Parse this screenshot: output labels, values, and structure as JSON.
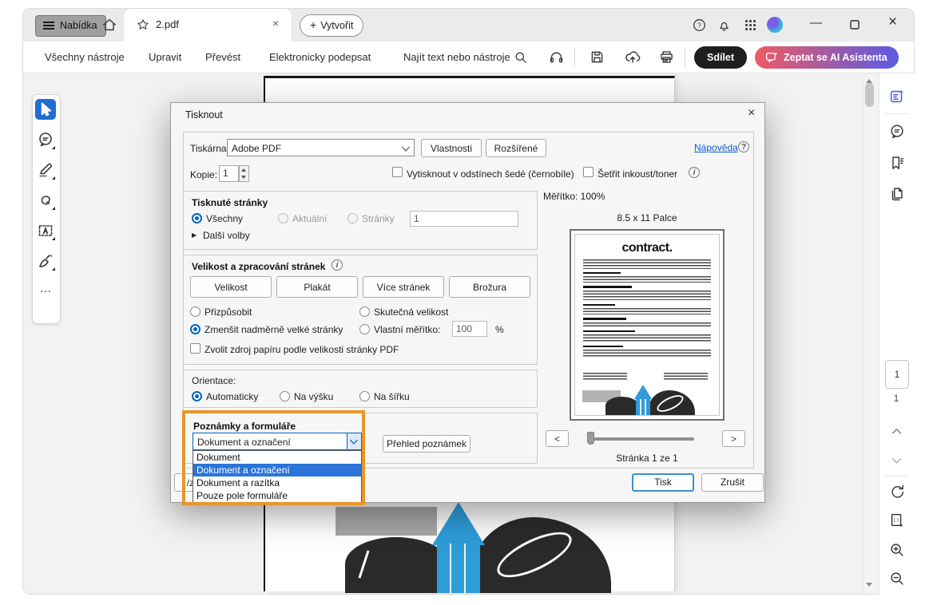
{
  "colors": {
    "accent_orange": "#E8962A",
    "selection_blue": "#2B74D9",
    "focus_blue": "#0067C0",
    "ai_grad_start": "#EF5B63",
    "ai_grad_end": "#5A5BE4",
    "share_black": "#1F1F1F",
    "pencil_blue": "#2E9CD9",
    "tool_active_blue": "#1E6ED6",
    "link_blue": "#0B5BD3",
    "ai_purple": "#5B5BE0"
  },
  "titlebar": {
    "menu": "Nabídka",
    "tab_title": "2.pdf",
    "create": "Vytvořit",
    "close_glyph": "×",
    "minimize_glyph": "—"
  },
  "toolbar": {
    "items": [
      "Všechny nástroje",
      "Upravit",
      "Převést",
      "Elektronicky podepsat"
    ],
    "search": "Najít text nebo nástroje",
    "share": "Sdílet",
    "ai": "Zeptat se AI Asistenta"
  },
  "right_panel": {
    "page_thumb": "1",
    "page_number": "1"
  },
  "print_dialog": {
    "title": "Tisknout",
    "close_glyph": "×",
    "printer": {
      "label": "Tiskárna:",
      "value": "Adobe PDF",
      "properties": "Vlastnosti",
      "advanced": "Rozšířené",
      "help": "Nápověda",
      "help_glyph": "?"
    },
    "copies": {
      "label": "Kopie:",
      "value": "1"
    },
    "grayscale_label": "Vytisknout v odstínech šedé (černobíle)",
    "save_ink_label": "Šetřit inkoust/toner",
    "info_glyph": "i",
    "pages_section": {
      "title": "Tisknuté stránky",
      "all": "Všechny",
      "current": "Aktuální",
      "pages": "Stránky",
      "pages_value": "1",
      "more_glyph": "▶",
      "more": "Další volby"
    },
    "size_section": {
      "title": "Velikost a zpracování stránek",
      "buttons": [
        "Velikost",
        "Plakát",
        "Více stránek",
        "Brožura"
      ],
      "fit": "Přizpůsobit",
      "actual": "Skutečná velikost",
      "shrink": "Zmenšit nadměrně velké stránky",
      "custom": "Vlastní měřítko:",
      "custom_value": "100",
      "percent": "%",
      "paper_source": "Zvolit zdroj papíru podle velikosti stránky PDF"
    },
    "orientation_section": {
      "title": "Orientace:",
      "auto": "Automaticky",
      "portrait": "Na výšku",
      "landscape": "Na šířku"
    },
    "comments_section": {
      "title": "Poznámky a formuláře",
      "selected": "Dokument a označení",
      "options": [
        "Dokument",
        "Dokument a označení",
        "Dokument a razítka",
        "Pouze pole formuláře"
      ],
      "summary_button": "Přehled poznámek"
    },
    "footer_fragment": "/z",
    "preview": {
      "scale_label": "Měřítko: 100%",
      "size_label": "8.5 x 11 Palce",
      "doc_title": "contract.",
      "prev": "<",
      "next": ">",
      "page_label": "Stránka 1 ze 1"
    },
    "actions": {
      "print": "Tisk",
      "cancel": "Zrušit"
    }
  },
  "icons": [
    "hamburger-icon",
    "home-icon",
    "star-icon",
    "tab-close-icon",
    "plus-icon",
    "search-icon",
    "headphones-icon",
    "save-icon",
    "cloud-upload-icon",
    "print-icon",
    "help-icon",
    "bell-icon",
    "apps-grid-icon",
    "avatar",
    "minimize-icon",
    "maximize-icon",
    "window-close-icon",
    "select-tool-icon",
    "comment-tool-icon",
    "highlight-tool-icon",
    "draw-tool-icon",
    "text-select-tool-icon",
    "sign-tool-icon",
    "more-tools-icon",
    "ai-assistant-panel-icon",
    "comments-panel-icon",
    "bookmarks-panel-icon",
    "pages-panel-icon",
    "chevron-up-icon",
    "chevron-down-icon",
    "rotate-icon",
    "fit-page-icon",
    "zoom-in-icon",
    "zoom-out-icon"
  ]
}
